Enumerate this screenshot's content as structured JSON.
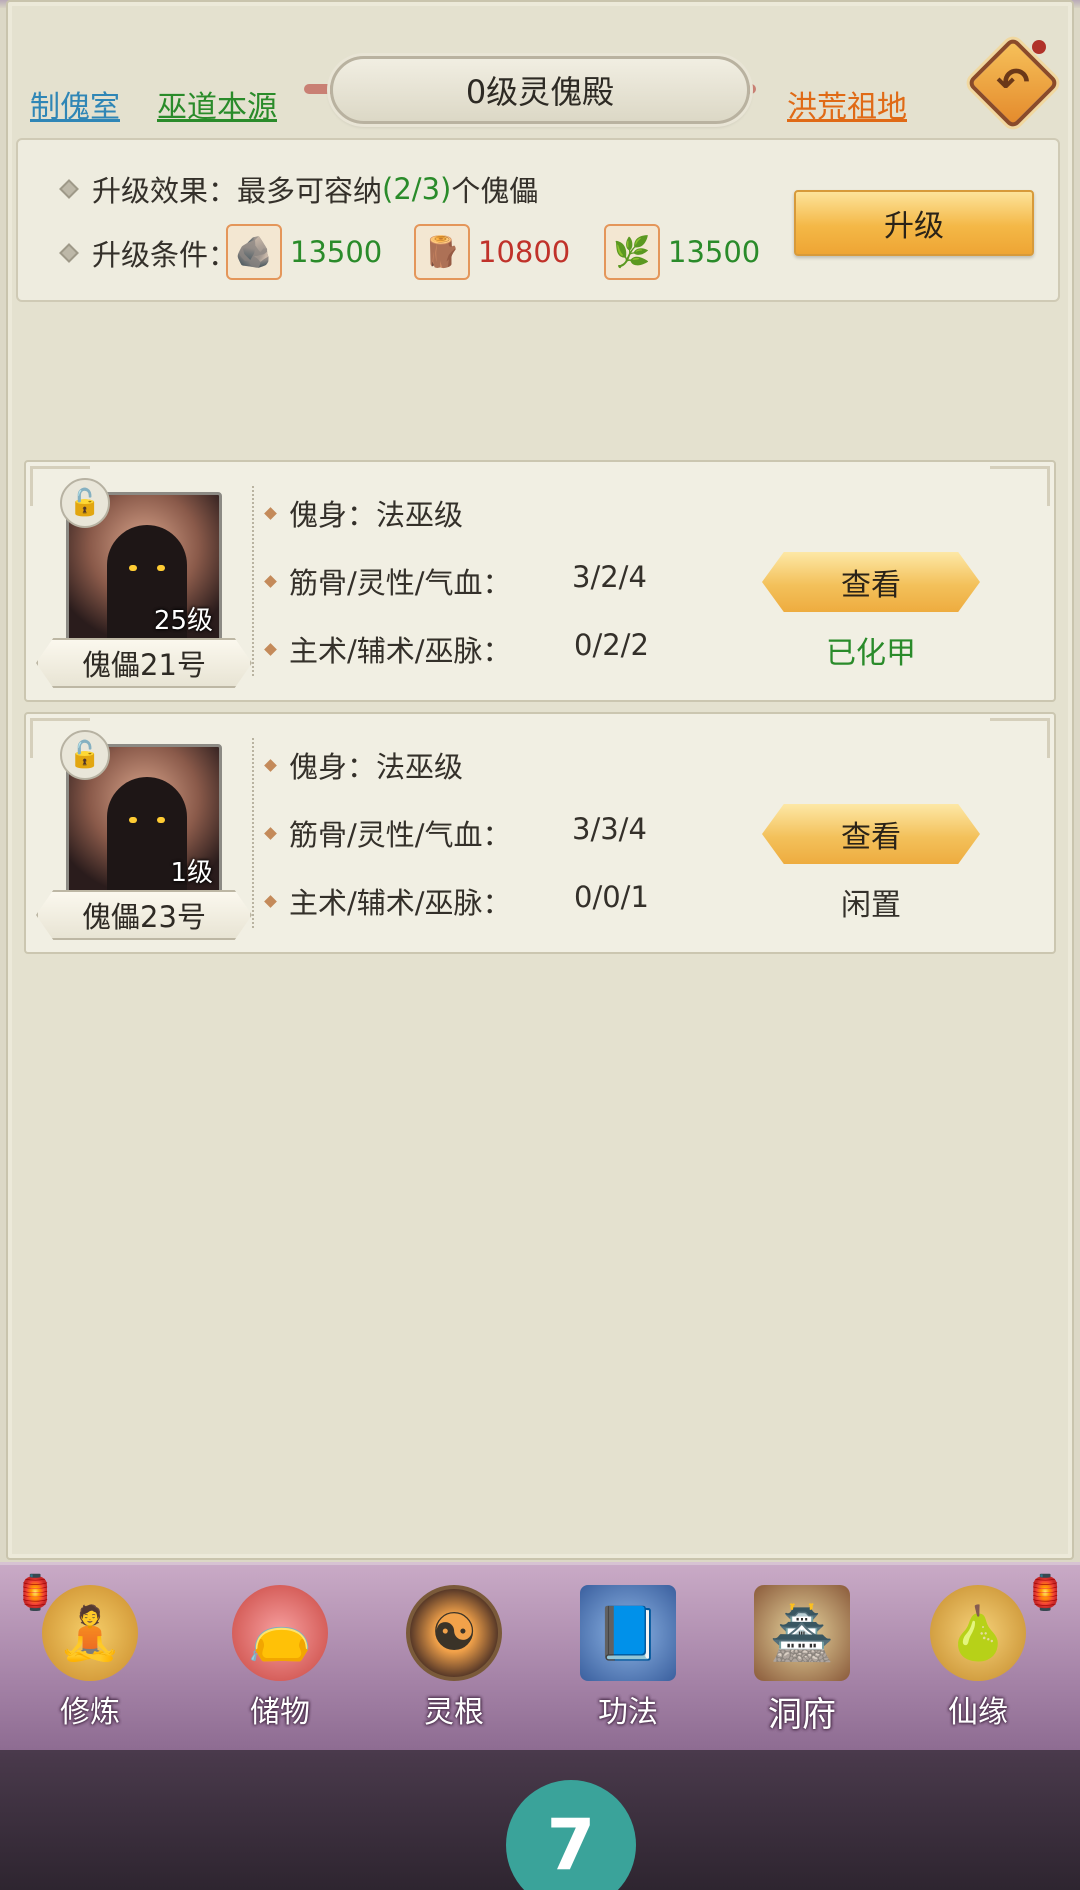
{
  "header": {
    "links": {
      "puppet_room": "制傀室",
      "wu_origin": "巫道本源",
      "ancestral_land": "洪荒祖地"
    },
    "title": "0级灵傀殿",
    "back_icon": "undo-arrow-icon"
  },
  "upgrade": {
    "effect_label": "升级效果：",
    "effect_prefix": "最多可容纳",
    "effect_count": "(2/3)",
    "effect_suffix": "个傀儡",
    "cond_label": "升级条件：",
    "resources": [
      {
        "icon": "ore-icon",
        "value": "13500",
        "color": "#2a8b2a"
      },
      {
        "icon": "wood-icon",
        "value": "10800",
        "color": "#c0322a"
      },
      {
        "icon": "herb-icon",
        "value": "13500",
        "color": "#2a8b2a"
      }
    ],
    "button_label": "升级"
  },
  "puppets": [
    {
      "name": "傀儡21号",
      "level": "25级",
      "body_label": "傀身：",
      "body_value": "法巫级",
      "attr_label": "筋骨/灵性/气血：",
      "attr_value": "3/2/4",
      "skill_label": "主术/辅术/巫脉：",
      "skill_value": "0/2/2",
      "view_label": "查看",
      "status": "已化甲",
      "status_color": "#2a8b2a"
    },
    {
      "name": "傀儡23号",
      "level": "1级",
      "body_label": "傀身：",
      "body_value": "法巫级",
      "attr_label": "筋骨/灵性/气血：",
      "attr_value": "3/3/4",
      "skill_label": "主术/辅术/巫脉：",
      "skill_value": "0/0/1",
      "view_label": "查看",
      "status": "闲置",
      "status_color": "#34302a"
    }
  ],
  "nav": [
    {
      "label": "修炼",
      "icon": "meditating-figure-icon"
    },
    {
      "label": "储物",
      "icon": "treasure-bag-icon"
    },
    {
      "label": "灵根",
      "icon": "spirit-root-icon"
    },
    {
      "label": "功法",
      "icon": "scroll-book-icon"
    },
    {
      "label": "洞府",
      "icon": "cave-house-icon"
    },
    {
      "label": "仙缘",
      "icon": "gourd-icon"
    }
  ],
  "floating": {
    "label": "7"
  }
}
